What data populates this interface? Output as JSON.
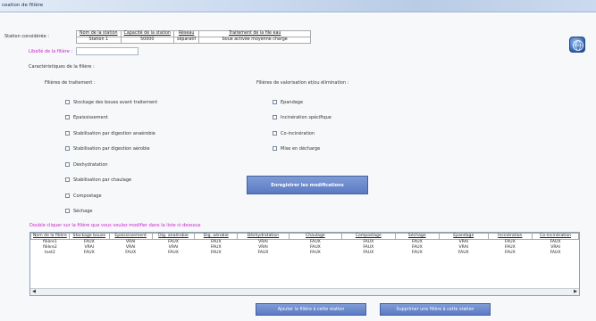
{
  "window": {
    "title": "ceation de filière"
  },
  "station": {
    "label": "Station considérée :",
    "headers": [
      "Nom de la station",
      "Capacité de la station",
      "Réseau",
      "Traitement de la file eau"
    ],
    "values": [
      "Station 1",
      "50000",
      "séparatif",
      "boue activée moyenne charge"
    ]
  },
  "libelle": {
    "label": "Libellé de la filière :",
    "value": ""
  },
  "caracteristiques_label": "Caractéristiques de la filière :",
  "traitement": {
    "label": "Filières de traitement :",
    "items": [
      "Stockage des boues avant traitement",
      "Epaississement",
      "Stabilisation par digestion anaérobie",
      "Stabilisation par digestion aérobie",
      "Déshydratation",
      "Stabilisation par chaulage",
      "Compostage",
      "Séchage"
    ]
  },
  "valorisation": {
    "label": "Filières de valorisation et/ou élimination :",
    "items": [
      "Epandage",
      "Incinération spécifique",
      "Co-incinération",
      "Mise en décharge"
    ]
  },
  "buttons": {
    "save": "Enregistrer les modifications",
    "add": "Ajouter la filière à cette station",
    "delete": "Supprimer une filière à cette station"
  },
  "hint": "Double cliquer sur la filière que vous voulez modifier dans la liste ci-dessous",
  "grid": {
    "columns": [
      "Nom de la filière",
      "Stockage boues",
      "Epaississement",
      "Dig. anaérobie",
      "Dig. aérobie",
      "Déshydratation",
      "Chaulage",
      "Compostage",
      "Séchage",
      "Epandage",
      "Incinération",
      "Co-incinération"
    ],
    "rows": [
      [
        "filière1",
        "FAUX",
        "VRAI",
        "FAUX",
        "FAUX",
        "VRAI",
        "FAUX",
        "FAUX",
        "FAUX",
        "VRAI",
        "FAUX",
        "FAUX"
      ],
      [
        "filière2",
        "VRAI",
        "VRAI",
        "VRAI",
        "FAUX",
        "VRAI",
        "FAUX",
        "FAUX",
        "FAUX",
        "VRAI",
        "FAUX",
        "VRAI"
      ],
      [
        "test2",
        "FAUX",
        "FAUX",
        "FAUX",
        "FAUX",
        "FAUX",
        "FAUX",
        "FAUX",
        "FAUX",
        "FAUX",
        "FAUX",
        "FAUX"
      ]
    ]
  },
  "icons": {
    "globe": "globe-icon",
    "scroll_left": "arrow-left-icon",
    "scroll_right": "arrow-right-icon"
  },
  "colors": {
    "accent": "#6482cb",
    "hint": "#cc22cc",
    "titlebar": "#c9d9ee"
  }
}
